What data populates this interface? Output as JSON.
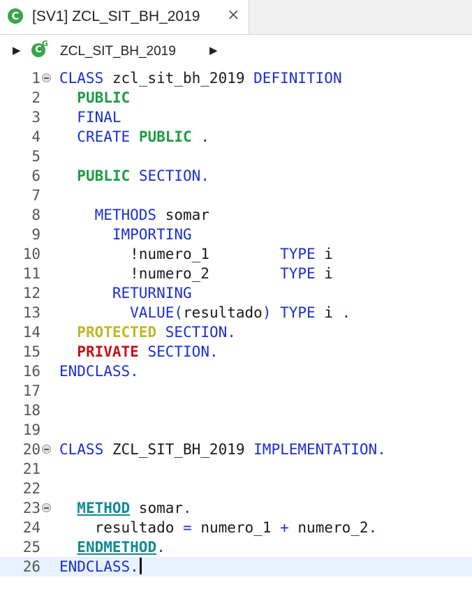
{
  "tab": {
    "title": "[SV1] ZCL_SIT_BH_2019",
    "icon": "class-icon",
    "icon_letter": "C",
    "close_glyph": "⨯"
  },
  "breadcrumb": {
    "icon": "global-class-icon",
    "icon_letter": "C",
    "icon_sup": "G",
    "label": "ZCL_SIT_BH_2019"
  },
  "colors": {
    "keyword": "#1a2fd1",
    "public": "#1e9c45",
    "protected": "#c1b62a",
    "private": "#c6111d",
    "method": "#118a93",
    "current_line": "#e8f2fe"
  },
  "editor": {
    "lines": [
      {
        "n": "1",
        "fold": true,
        "tokens": [
          {
            "t": "CLASS",
            "c": "kw"
          },
          {
            "t": " zcl_sit_bh_2019 ",
            "c": "id"
          },
          {
            "t": "DEFINITION",
            "c": "kw"
          }
        ]
      },
      {
        "n": "2",
        "tokens": [
          {
            "t": "  ",
            "c": "id"
          },
          {
            "t": "PUBLIC",
            "c": "pub"
          }
        ]
      },
      {
        "n": "3",
        "tokens": [
          {
            "t": "  ",
            "c": "id"
          },
          {
            "t": "FINAL",
            "c": "kw"
          }
        ]
      },
      {
        "n": "4",
        "tokens": [
          {
            "t": "  ",
            "c": "id"
          },
          {
            "t": "CREATE",
            "c": "kw"
          },
          {
            "t": " ",
            "c": "id"
          },
          {
            "t": "PUBLIC",
            "c": "pub"
          },
          {
            "t": " .",
            "c": "kw"
          }
        ]
      },
      {
        "n": "5",
        "tokens": []
      },
      {
        "n": "6",
        "tokens": [
          {
            "t": "  ",
            "c": "id"
          },
          {
            "t": "PUBLIC",
            "c": "pub"
          },
          {
            "t": " ",
            "c": "id"
          },
          {
            "t": "SECTION.",
            "c": "kw"
          }
        ]
      },
      {
        "n": "7",
        "tokens": []
      },
      {
        "n": "8",
        "tokens": [
          {
            "t": "    ",
            "c": "id"
          },
          {
            "t": "METHODS",
            "c": "kw"
          },
          {
            "t": " somar",
            "c": "id"
          }
        ]
      },
      {
        "n": "9",
        "tokens": [
          {
            "t": "      ",
            "c": "id"
          },
          {
            "t": "IMPORTING",
            "c": "kw"
          }
        ]
      },
      {
        "n": "10",
        "tokens": [
          {
            "t": "        !numero_1        ",
            "c": "id"
          },
          {
            "t": "TYPE",
            "c": "kw"
          },
          {
            "t": " i",
            "c": "id"
          }
        ]
      },
      {
        "n": "11",
        "tokens": [
          {
            "t": "        !numero_2        ",
            "c": "id"
          },
          {
            "t": "TYPE",
            "c": "kw"
          },
          {
            "t": " i",
            "c": "id"
          }
        ]
      },
      {
        "n": "12",
        "tokens": [
          {
            "t": "      ",
            "c": "id"
          },
          {
            "t": "RETURNING",
            "c": "kw"
          }
        ]
      },
      {
        "n": "13",
        "tokens": [
          {
            "t": "        ",
            "c": "id"
          },
          {
            "t": "VALUE(",
            "c": "kw"
          },
          {
            "t": "resultado",
            "c": "id"
          },
          {
            "t": ")",
            "c": "kw"
          },
          {
            "t": " ",
            "c": "id"
          },
          {
            "t": "TYPE",
            "c": "kw"
          },
          {
            "t": " i ",
            "c": "id"
          },
          {
            "t": ".",
            "c": "kw"
          }
        ]
      },
      {
        "n": "14",
        "tokens": [
          {
            "t": "  ",
            "c": "id"
          },
          {
            "t": "PROTECTED",
            "c": "prot"
          },
          {
            "t": " ",
            "c": "id"
          },
          {
            "t": "SECTION.",
            "c": "kw"
          }
        ]
      },
      {
        "n": "15",
        "tokens": [
          {
            "t": "  ",
            "c": "id"
          },
          {
            "t": "PRIVATE",
            "c": "priv"
          },
          {
            "t": " ",
            "c": "id"
          },
          {
            "t": "SECTION.",
            "c": "kw"
          }
        ]
      },
      {
        "n": "16",
        "tokens": [
          {
            "t": "ENDCLASS.",
            "c": "kw"
          }
        ]
      },
      {
        "n": "17",
        "tokens": []
      },
      {
        "n": "18",
        "tokens": []
      },
      {
        "n": "19",
        "tokens": []
      },
      {
        "n": "20",
        "fold": true,
        "tokens": [
          {
            "t": "CLASS",
            "c": "kw"
          },
          {
            "t": " ZCL_SIT_BH_2019 ",
            "c": "id"
          },
          {
            "t": "IMPLEMENTATION.",
            "c": "kw"
          }
        ]
      },
      {
        "n": "21",
        "tokens": []
      },
      {
        "n": "22",
        "tokens": []
      },
      {
        "n": "23",
        "fold": true,
        "tokens": [
          {
            "t": "  ",
            "c": "id"
          },
          {
            "t": "METHOD",
            "c": "meth"
          },
          {
            "t": " somar",
            "c": "id"
          },
          {
            "t": ".",
            "c": "kw"
          }
        ]
      },
      {
        "n": "24",
        "tokens": [
          {
            "t": "    resultado ",
            "c": "id"
          },
          {
            "t": "=",
            "c": "op"
          },
          {
            "t": " numero_1 ",
            "c": "id"
          },
          {
            "t": "+",
            "c": "op"
          },
          {
            "t": " numero_2",
            "c": "id"
          },
          {
            "t": ".",
            "c": "kw"
          }
        ]
      },
      {
        "n": "25",
        "tokens": [
          {
            "t": "  ",
            "c": "id"
          },
          {
            "t": "ENDMETHOD",
            "c": "meth"
          },
          {
            "t": ".",
            "c": "kw"
          }
        ]
      },
      {
        "n": "26",
        "current": true,
        "cursor": true,
        "tokens": [
          {
            "t": "ENDCLASS.",
            "c": "kw"
          }
        ]
      }
    ]
  }
}
